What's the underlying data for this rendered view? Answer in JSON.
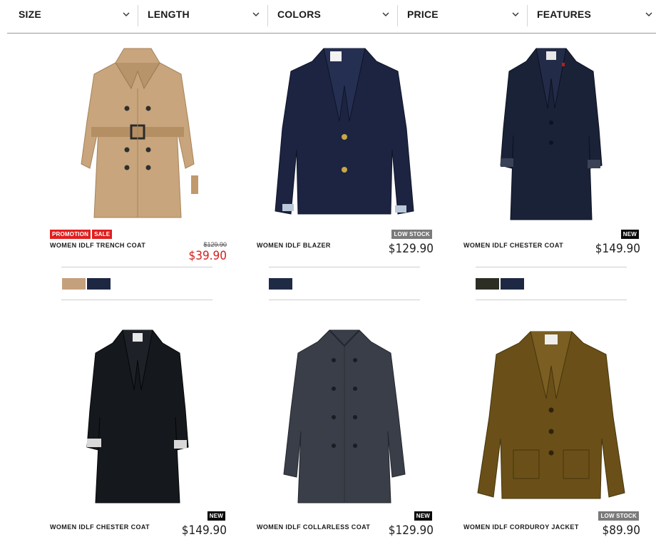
{
  "filters": [
    {
      "label": "SIZE"
    },
    {
      "label": "LENGTH"
    },
    {
      "label": "COLORS"
    },
    {
      "label": "PRICE"
    },
    {
      "label": "FEATURES"
    }
  ],
  "products": [
    {
      "name": "WOMEN IDLF TRENCH COAT",
      "badges": [
        "PROMOTION",
        "SALE"
      ],
      "old_price": "$129.90",
      "price": "$39.90",
      "swatches": [
        "#c4a07c",
        "#1d2742"
      ],
      "image": "trench-coat-beige",
      "color": "#c9a37a"
    },
    {
      "name": "WOMEN IDLF BLAZER",
      "badges": [
        "LOW STOCK"
      ],
      "price": "$129.90",
      "swatches": [
        "#1f2a45"
      ],
      "image": "blazer-navy",
      "color": "#1c2441"
    },
    {
      "name": "WOMEN IDLF CHESTER COAT",
      "badges": [
        "NEW"
      ],
      "price": "$149.90",
      "swatches": [
        "#2c2e24",
        "#1e2843"
      ],
      "image": "chester-coat-navy",
      "color": "#1a2238"
    },
    {
      "name": "WOMEN IDLF CHESTER COAT",
      "badges": [
        "NEW"
      ],
      "price": "$149.90",
      "image": "chester-coat-black",
      "color": "#15181c"
    },
    {
      "name": "WOMEN IDLF COLLARLESS COAT",
      "badges": [
        "NEW"
      ],
      "price": "$129.90",
      "image": "collarless-coat-charcoal",
      "color": "#3a3e48"
    },
    {
      "name": "WOMEN IDLF CORDUROY JACKET",
      "badges": [
        "LOW STOCK"
      ],
      "price": "$89.90",
      "image": "corduroy-jacket-brown",
      "color": "#6a5018"
    }
  ]
}
